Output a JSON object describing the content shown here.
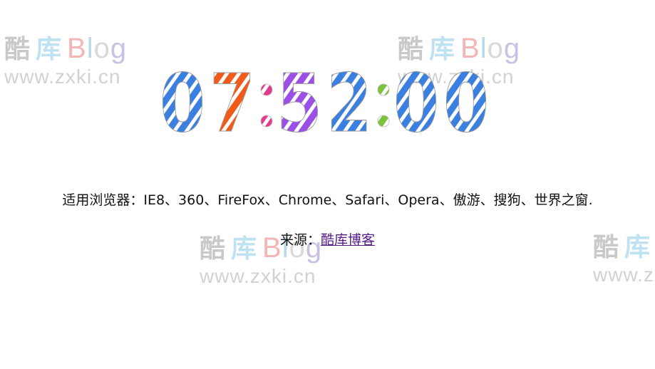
{
  "clock": {
    "hours": "07",
    "minutes": "52",
    "seconds": "00",
    "digit_colors": {
      "0": "#3b7fe0",
      "7": "#f05a1a",
      "5": "#9b4fe6",
      "2": "#3b7fe0"
    },
    "separator_colors": [
      "#e23a8c",
      "#7cc23a"
    ]
  },
  "browsers_text": "适用浏览器：IE8、360、FireFox、Chrome、Safari、Opera、傲游、搜狗、世界之窗.",
  "source": {
    "label": "来源：",
    "link_text": "酷库博客"
  },
  "watermark": {
    "cn": "酷库",
    "cn_part1": "酷",
    "cn_part2": "库",
    "blog_b": "B",
    "blog_l": "l",
    "blog_o": "o",
    "blog_g": "g",
    "url": "www.zxki.cn"
  }
}
